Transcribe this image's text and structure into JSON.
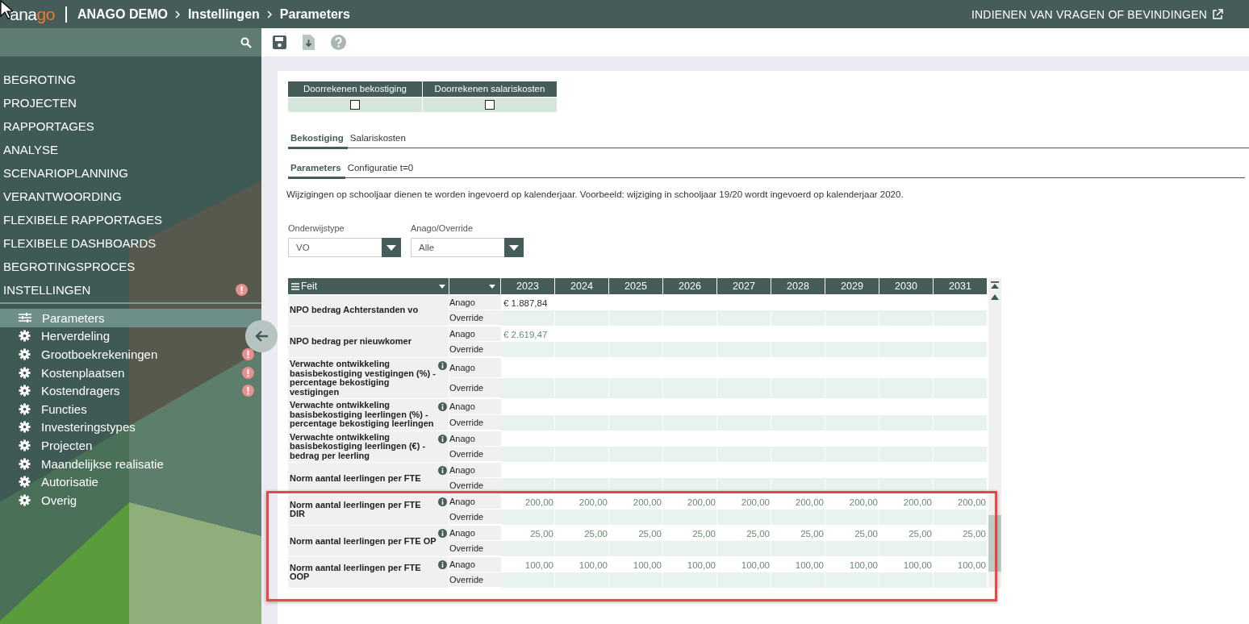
{
  "header": {
    "logo_main": "ana",
    "logo_accent": "go",
    "breadcrumb": [
      "ANAGO DEMO",
      "Instellingen",
      "Parameters"
    ],
    "feedback_link": "INDIENEN VAN VRAGEN OF BEVINDINGEN"
  },
  "sidebar": {
    "items": [
      {
        "label": "BEGROTING",
        "alert": false
      },
      {
        "label": "PROJECTEN",
        "alert": false
      },
      {
        "label": "RAPPORTAGES",
        "alert": false
      },
      {
        "label": "ANALYSE",
        "alert": false
      },
      {
        "label": "SCENARIOPLANNING",
        "alert": false
      },
      {
        "label": "VERANTWOORDING",
        "alert": false
      },
      {
        "label": "FLEXIBELE RAPPORTAGES",
        "alert": false
      },
      {
        "label": "FLEXIBELE DASHBOARDS",
        "alert": false
      },
      {
        "label": "BEGROTINGSPROCES",
        "alert": false
      },
      {
        "label": "INSTELLINGEN",
        "alert": true
      }
    ],
    "subitems": [
      {
        "label": "Parameters",
        "kind": "sliders",
        "selected": true,
        "alert": false
      },
      {
        "label": "Herverdeling",
        "kind": "gear",
        "selected": false,
        "alert": false
      },
      {
        "label": "Grootboekrekeningen",
        "kind": "gear",
        "selected": false,
        "alert": true
      },
      {
        "label": "Kostenplaatsen",
        "kind": "gear",
        "selected": false,
        "alert": true
      },
      {
        "label": "Kostendragers",
        "kind": "gear",
        "selected": false,
        "alert": true
      },
      {
        "label": "Functies",
        "kind": "gear",
        "selected": false,
        "alert": false
      },
      {
        "label": "Investeringstypes",
        "kind": "gear",
        "selected": false,
        "alert": false
      },
      {
        "label": "Projecten",
        "kind": "gear",
        "selected": false,
        "alert": false
      },
      {
        "label": "Maandelijkse realisatie",
        "kind": "gear",
        "selected": false,
        "alert": false
      },
      {
        "label": "Autorisatie",
        "kind": "gear",
        "selected": false,
        "alert": false
      },
      {
        "label": "Overig",
        "kind": "gear",
        "selected": false,
        "alert": false
      }
    ]
  },
  "toggles": [
    {
      "label": "Doorrekenen bekostiging",
      "checked": false
    },
    {
      "label": "Doorrekenen salariskosten",
      "checked": false
    }
  ],
  "tabs": [
    {
      "label": "Bekostiging",
      "selected": true
    },
    {
      "label": "Salariskosten",
      "selected": false
    }
  ],
  "subtabs": [
    {
      "label": "Parameters",
      "selected": true
    },
    {
      "label": "Configuratie t=0",
      "selected": false
    }
  ],
  "note": "Wijzigingen op schooljaar dienen te worden ingevoerd op kalenderjaar. Voorbeeld: wijziging in schooljaar 19/20 wordt ingevoerd op kalenderjaar 2020.",
  "filters": [
    {
      "label": "Onderwijstype",
      "value": "VO"
    },
    {
      "label": "Anago/Override",
      "value": "Alle"
    }
  ],
  "table": {
    "column_1": "Feit",
    "years": [
      "2023",
      "2024",
      "2025",
      "2026",
      "2027",
      "2028",
      "2029",
      "2030",
      "2031"
    ],
    "groups": [
      {
        "highlighted": false,
        "facts": [
          {
            "label": "NPO bedrag Achterstanden vo",
            "info": false,
            "kind": "currency",
            "dimmed": false,
            "values": [
              "€ 1.887,84"
            ],
            "row_labels": [
              "Anago",
              "Override"
            ]
          },
          {
            "label": "NPO bedrag per nieuwkomer",
            "info": false,
            "kind": "currency",
            "dimmed": true,
            "values": [
              "€ 2.619,47"
            ],
            "row_labels": [
              "Anago",
              "Override"
            ]
          },
          {
            "label": "Verwachte ontwikkeling basisbekostiging vestigingen (%) - percentage bekostiging vestigingen",
            "info": true,
            "row_labels": [
              "Anago",
              "Override"
            ]
          },
          {
            "label": "Verwachte ontwikkeling basisbekostiging leerlingen (%) - percentage bekostiging leerlingen",
            "info": true,
            "row_labels": [
              "Anago",
              "Override"
            ]
          },
          {
            "label": "Verwachte ontwikkeling basisbekostiging leerlingen (€) - bedrag per leerling",
            "info": true,
            "row_labels": [
              "Anago",
              "Override"
            ]
          },
          {
            "label": "Norm aantal leerlingen per FTE",
            "info": true,
            "row_labels": [
              "Anago",
              "Override"
            ]
          }
        ]
      },
      {
        "highlighted": true,
        "facts": [
          {
            "label": "Norm aantal leerlingen per FTE DIR",
            "info": true,
            "kind": "number",
            "dimmed": true,
            "values": [
              "200,00",
              "200,00",
              "200,00",
              "200,00",
              "200,00",
              "200,00",
              "200,00",
              "200,00",
              "200,00"
            ],
            "row_labels": [
              "Anago",
              "Override"
            ]
          },
          {
            "label": "Norm aantal leerlingen per FTE OP",
            "info": true,
            "kind": "number",
            "dimmed": true,
            "values": [
              "25,00",
              "25,00",
              "25,00",
              "25,00",
              "25,00",
              "25,00",
              "25,00",
              "25,00",
              "25,00"
            ],
            "row_labels": [
              "Anago",
              "Override"
            ]
          },
          {
            "label": "Norm aantal leerlingen per FTE OOP",
            "info": true,
            "kind": "number",
            "dimmed": true,
            "values": [
              "100,00",
              "100,00",
              "100,00",
              "100,00",
              "100,00",
              "100,00",
              "100,00",
              "100,00",
              "100,00"
            ],
            "row_labels": [
              "Anago",
              "Override"
            ]
          }
        ]
      }
    ]
  }
}
